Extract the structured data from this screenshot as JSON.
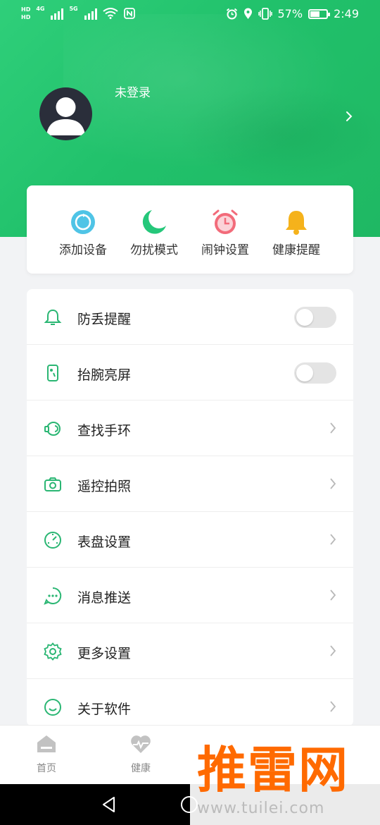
{
  "status_bar": {
    "net1": "4G",
    "net2": "5G",
    "battery": "57%",
    "time": "2:49"
  },
  "profile": {
    "login_text": "未登录"
  },
  "quick_actions": [
    {
      "label": "添加设备",
      "icon": "add-device-icon",
      "color": "#4fc4e6"
    },
    {
      "label": "勿扰模式",
      "icon": "moon-icon",
      "color": "#25c77a"
    },
    {
      "label": "闹钟设置",
      "icon": "alarm-clock-icon",
      "color": "#f26b7a"
    },
    {
      "label": "健康提醒",
      "icon": "bell-icon",
      "color": "#f5b21b"
    }
  ],
  "settings": [
    {
      "label": "防丢提醒",
      "icon": "bell-outline-icon",
      "control": "toggle",
      "on": false
    },
    {
      "label": "抬腕亮屏",
      "icon": "wrist-raise-icon",
      "control": "toggle",
      "on": false
    },
    {
      "label": "查找手环",
      "icon": "find-band-icon",
      "control": "chevron"
    },
    {
      "label": "遥控拍照",
      "icon": "camera-icon",
      "control": "chevron"
    },
    {
      "label": "表盘设置",
      "icon": "watch-face-icon",
      "control": "chevron"
    },
    {
      "label": "消息推送",
      "icon": "message-icon",
      "control": "chevron"
    },
    {
      "label": "更多设置",
      "icon": "gear-icon",
      "control": "chevron"
    },
    {
      "label": "关于软件",
      "icon": "smile-icon",
      "control": "chevron"
    }
  ],
  "tabs": [
    {
      "label": "首页",
      "icon": "home-icon"
    },
    {
      "label": "健康",
      "icon": "heart-icon"
    }
  ],
  "watermark": {
    "title": "推雷网",
    "url": "www.tuilei.com"
  },
  "colors": {
    "brand_green": "#21c16b",
    "icon_green": "#2ab673"
  }
}
